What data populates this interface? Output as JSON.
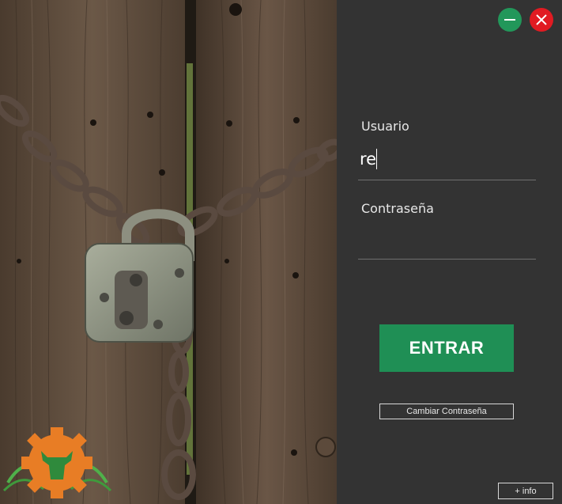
{
  "window": {
    "minimize_icon": "minus-icon",
    "close_icon": "x-icon",
    "minimize_color": "#22975a",
    "close_color": "#e11b22"
  },
  "login": {
    "user_label": "Usuario",
    "user_value": "re",
    "password_label": "Contraseña",
    "password_value": "",
    "enter_button": "ENTRAR",
    "change_password_button": "Cambiar Contraseña",
    "info_button": "+ info",
    "accent": "#1f8f55"
  },
  "image": {
    "subject": "padlock-chain-wooden-door",
    "logo": "gear-bull-logo"
  }
}
